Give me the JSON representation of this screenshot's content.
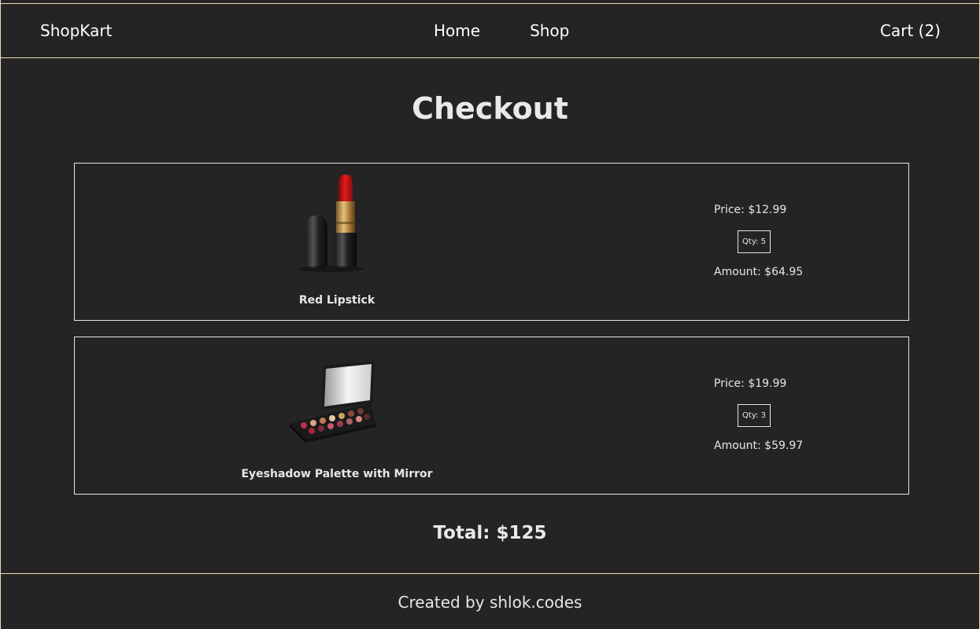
{
  "header": {
    "brand": "ShopKart",
    "nav": [
      "Home",
      "Shop"
    ],
    "cart_label": "Cart (2)"
  },
  "main": {
    "title": "Checkout",
    "items": [
      {
        "name": "Red Lipstick",
        "price": "Price: $12.99",
        "qty": "Qty: 5",
        "amount": "Amount: $64.95",
        "image_icon": "lipstick-icon"
      },
      {
        "name": "Eyeshadow Palette with Mirror",
        "price": "Price: $19.99",
        "qty": "Qty: 3",
        "amount": "Amount: $59.97",
        "image_icon": "eyeshadow-palette-icon"
      }
    ],
    "total": "Total: $125"
  },
  "footer": {
    "text": "Created by shlok.codes"
  },
  "colors": {
    "background": "#242424",
    "accent_border": "#f0dcb8",
    "text": "#e6e6e6"
  }
}
